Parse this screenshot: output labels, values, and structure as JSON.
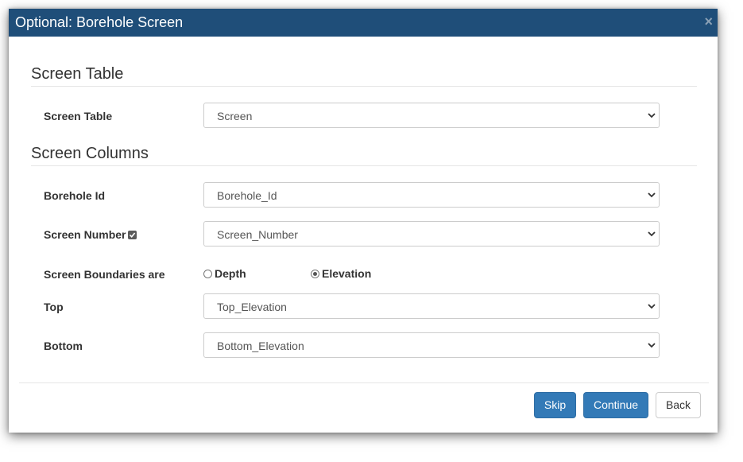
{
  "dialog": {
    "title": "Optional: Borehole Screen",
    "close_symbol": "×",
    "colors": {
      "titlebar": "#1f4e79",
      "primary_button": "#337ab7"
    }
  },
  "sections": {
    "table": {
      "heading": "Screen Table",
      "fields": {
        "screen_table": {
          "label": "Screen Table",
          "value": "Screen"
        }
      }
    },
    "columns": {
      "heading": "Screen Columns",
      "fields": {
        "borehole_id": {
          "label": "Borehole Id",
          "value": "Borehole_Id"
        },
        "screen_number": {
          "label": "Screen Number",
          "value": "Screen_Number",
          "checkbox_checked": true
        },
        "boundaries": {
          "label": "Screen Boundaries are",
          "options": [
            {
              "label": "Depth",
              "checked": false
            },
            {
              "label": "Elevation",
              "checked": true
            }
          ]
        },
        "top": {
          "label": "Top",
          "value": "Top_Elevation"
        },
        "bottom": {
          "label": "Bottom",
          "value": "Bottom_Elevation"
        }
      }
    }
  },
  "footer": {
    "skip_label": "Skip",
    "continue_label": "Continue",
    "back_label": "Back"
  },
  "icons": {
    "select_chevron": "chevron-down-icon",
    "close": "close-icon",
    "checkbox": "checkbox-checked-icon"
  }
}
